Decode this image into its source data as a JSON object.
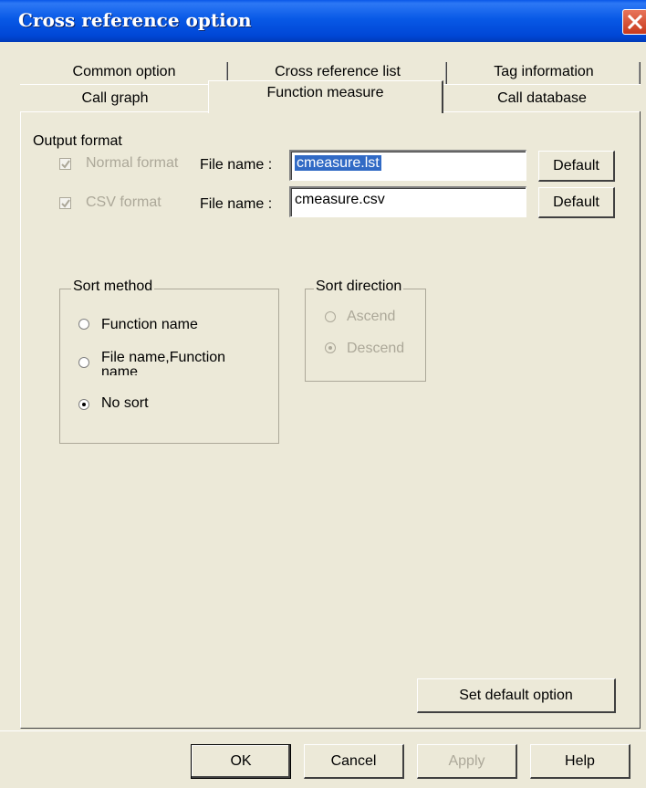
{
  "window": {
    "title": "Cross reference option"
  },
  "tabs": {
    "row1": [
      "Common option",
      "Cross reference list",
      "Tag information"
    ],
    "row2": [
      "Call graph",
      "Function measure",
      "Call database"
    ],
    "active": "Function measure"
  },
  "output_format": {
    "group_label": "Output format",
    "normal": {
      "checkbox_label": "Normal format",
      "checked": true,
      "file_label": "File name :",
      "value": "cmeasure.lst",
      "default_label": "Default"
    },
    "csv": {
      "checkbox_label": "CSV format",
      "checked": true,
      "file_label": "File name :",
      "value": "cmeasure.csv",
      "default_label": "Default"
    }
  },
  "sort_method": {
    "title": "Sort method",
    "options": [
      "Function name",
      "File name,Function name",
      "No sort"
    ],
    "selected": "No sort"
  },
  "sort_direction": {
    "title": "Sort direction",
    "options": [
      "Ascend",
      "Descend"
    ],
    "selected": "Descend"
  },
  "buttons": {
    "set_default": "Set default option",
    "ok": "OK",
    "cancel": "Cancel",
    "apply": "Apply",
    "help": "Help"
  }
}
